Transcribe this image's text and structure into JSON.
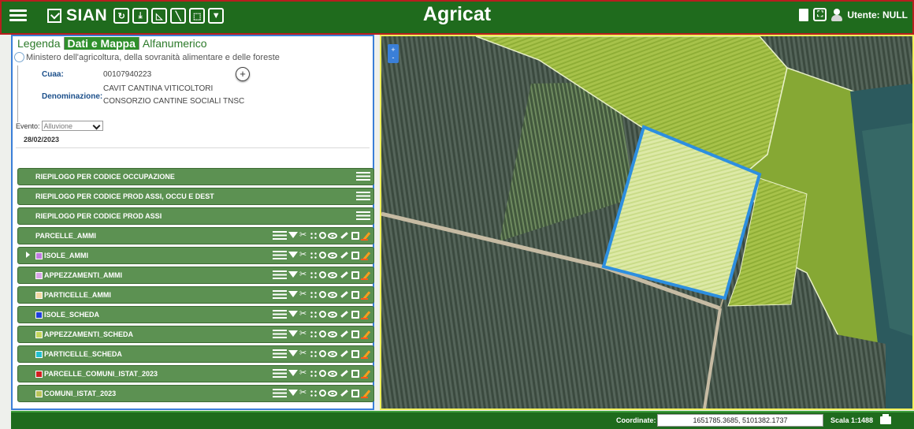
{
  "topbar": {
    "brand": "SIAN",
    "title": "Agricat",
    "user_label": "Utente: NULL",
    "tools": [
      {
        "name": "refresh-tool",
        "glyph": "↻"
      },
      {
        "name": "download-tool",
        "glyph": "⤓"
      },
      {
        "name": "triangle-tool",
        "glyph": "◺"
      },
      {
        "name": "line-tool",
        "glyph": "╲"
      },
      {
        "name": "select-tool",
        "glyph": "⬚"
      },
      {
        "name": "filter-tool",
        "glyph": "▼"
      }
    ]
  },
  "panel": {
    "tabs": [
      "Legenda",
      "Dati e Mappa",
      "Alfanumerico"
    ],
    "active_tab": "Dati e Mappa",
    "ministry": "Ministero dell'agricoltura, della sovranità alimentare e delle foreste",
    "cuaa_label": "Cuaa:",
    "cuaa_value": "00107940223",
    "denominazione_label": "Denominazione:",
    "denominazione_line1": "CAVIT CANTINA VITICOLTORI",
    "denominazione_line2": "CONSORZIO CANTINE SOCIALI TNSC",
    "plus_label": "+",
    "evento_label": "Evento:",
    "evento_value": "Alluvione",
    "date": "28/02/2023"
  },
  "layers": [
    {
      "title": "RIEPILOGO PER CODICE OCCUPAZIONE",
      "kind": "summary"
    },
    {
      "title": "RIEPILOGO PER CODICE PROD ASSI, OCCU E DEST",
      "kind": "summary"
    },
    {
      "title": "RIEPILOGO PER CODICE PROD ASSI",
      "kind": "summary"
    },
    {
      "title": "PARCELLE_AMMI",
      "kind": "layer"
    },
    {
      "title": "ISOLE_AMMI",
      "kind": "layer",
      "swatch": "#c07adf",
      "caret": true
    },
    {
      "title": "APPEZZAMENTI_AMMI",
      "kind": "layer",
      "swatch": "#d9a6e8"
    },
    {
      "title": "PARTICELLE_AMMI",
      "kind": "layer",
      "swatch": "#f3d8a2"
    },
    {
      "title": "ISOLE_SCHEDA",
      "kind": "layer",
      "swatch": "#1f3fdc"
    },
    {
      "title": "APPEZZAMENTI_SCHEDA",
      "kind": "layer",
      "swatch": "#c6d65c"
    },
    {
      "title": "PARTICELLE_SCHEDA",
      "kind": "layer",
      "swatch": "#22c0d0"
    },
    {
      "title": "PARCELLE_COMUNI_ISTAT_2023",
      "kind": "layer",
      "swatch": "#d11f1f"
    },
    {
      "title": "COMUNI_ISTAT_2023",
      "kind": "layer",
      "swatch": "#b9c458"
    }
  ],
  "map": {
    "zoom_in": "+",
    "zoom_out": "-",
    "selection_color": "#2d8fe0"
  },
  "footer": {
    "coord_label": "Coordinate:",
    "coord_value": "1651785.3685, 5101382.1737",
    "scale": "Scala 1:1488"
  },
  "colors": {
    "bar_green": "#1f6b1d",
    "layer_green": "#5c9152",
    "panel_border": "#3a7fd8",
    "map_border": "#f1f05a"
  }
}
